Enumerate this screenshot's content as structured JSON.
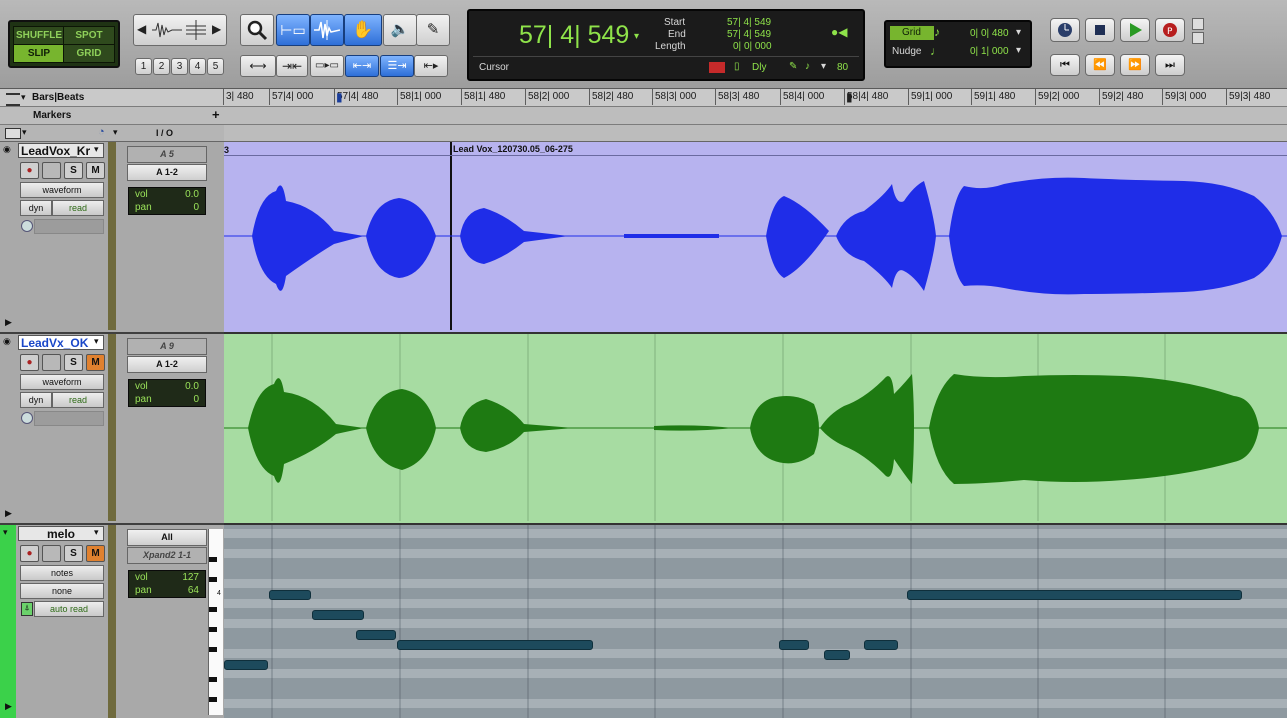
{
  "toolbar": {
    "modes": {
      "shuffle": "SHUFFLE",
      "spot": "SPOT",
      "slip": "SLIP",
      "grid": "GRID"
    },
    "zoom_presets": [
      "1",
      "2",
      "3",
      "4",
      "5"
    ]
  },
  "counter": {
    "main": "57| 4| 549",
    "start_label": "Start",
    "start": "57| 4| 549",
    "end_label": "End",
    "end": "57| 4| 549",
    "length_label": "Length",
    "length": "0| 0| 000",
    "cursor_label": "Cursor",
    "dly_label": "Dly",
    "nudge_value_right": "80"
  },
  "grid": {
    "grid_label": "Grid",
    "grid_value": "0| 0| 480",
    "nudge_label": "Nudge",
    "nudge_value": "0| 1| 000"
  },
  "ruler": {
    "label": "Bars|Beats",
    "ticks": [
      "3| 480",
      "57|4| 000",
      "57|4| 480",
      "58|1| 000",
      "58|1| 480",
      "58|2| 000",
      "58|2| 480",
      "58|3| 000",
      "58|3| 480",
      "58|4| 000",
      "58|4| 480",
      "59|1| 000",
      "59|1| 480",
      "59|2| 000",
      "59|2| 480",
      "59|3| 000",
      "59|3| 480"
    ],
    "markers_label": "Markers"
  },
  "header_row": {
    "io_label": "I / O"
  },
  "tracks": [
    {
      "name": "LeadVox_Kr",
      "s": "S",
      "m": "M",
      "view": "waveform",
      "dyn": "dyn",
      "auto": "read",
      "input": "A 5",
      "output": "A 1-2",
      "vol_label": "vol",
      "vol": "0.0",
      "pan_label": "pan",
      "pan": "0",
      "clip": "Lead Vox_120730.05_06-275",
      "clip_prev": "3"
    },
    {
      "name": "LeadVx_OK",
      "s": "S",
      "m": "M",
      "view": "waveform",
      "dyn": "dyn",
      "auto": "read",
      "input": "A 9",
      "output": "A 1-2",
      "vol_label": "vol",
      "vol": "0.0",
      "pan_label": "pan",
      "pan": "0"
    },
    {
      "name": "melo",
      "s": "S",
      "m": "M",
      "view": "notes",
      "sub": "none",
      "auto": "auto read",
      "input": "All",
      "output": "Xpand2 1-1",
      "vol_label": "vol",
      "vol": "127",
      "pan_label": "pan",
      "pan": "64",
      "octave_mark": "4"
    }
  ],
  "colors": {
    "lane1_bg": "#b7b3ef",
    "lane1_wave": "#1f2de8",
    "lane2_bg": "#a7dca2",
    "lane2_wave": "#1e7a12",
    "midi_bg": "#8e99a0",
    "note": "#1d4a5c"
  }
}
